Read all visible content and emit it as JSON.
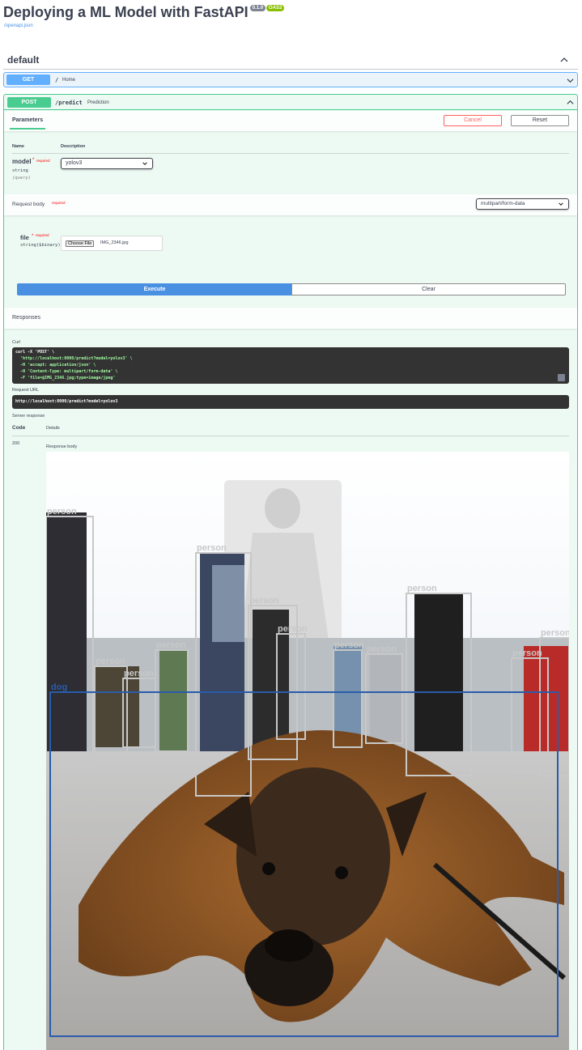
{
  "header": {
    "title": "Deploying a ML Model with FastAPI",
    "version_badge": "0.1.0",
    "oas_badge": "OAS3",
    "openapi_link": "/openapi.json"
  },
  "tag": {
    "name": "default"
  },
  "get_op": {
    "method": "GET",
    "path": "/",
    "summary": "Home"
  },
  "post_op": {
    "method": "POST",
    "path": "/predict",
    "summary": "Prediction",
    "tab_parameters": "Parameters",
    "cancel_label": "Cancel",
    "reset_label": "Reset",
    "col_name": "Name",
    "col_description": "Description",
    "param": {
      "name": "model",
      "required_star": "*",
      "required_text": "required",
      "type": "string",
      "location": "(query)",
      "value": "yolov3"
    },
    "request_body": {
      "label": "Request body",
      "required_text": "required",
      "content_type": "multipart/form-data",
      "field_name": "file",
      "field_required_star": "*",
      "field_required_text": "required",
      "field_type": "string($binary)",
      "choose_file_label": "Choose File",
      "file_name": "IMG_2346.jpg"
    },
    "execute_label": "Execute",
    "clear_label": "Clear",
    "responses_label": "Responses",
    "curl_label": "Curl",
    "curl_lines": [
      "curl -X 'POST' \\",
      "  'http://localhost:8000/predict?model=yolov3' \\",
      "  -H 'accept: application/json' \\",
      "  -H 'Content-Type: multipart/form-data' \\",
      "  -F 'file=@IMG_2346.jpg;type=image/jpeg'"
    ],
    "request_url_label": "Request URL",
    "request_url": "http://localhost:8000/predict?model=yolov3",
    "server_response_label": "Server response",
    "col_code": "Code",
    "col_details": "Details",
    "response_code": "200",
    "response_body_label": "Response body"
  },
  "detections": [
    {
      "label": "person"
    },
    {
      "label": "person"
    },
    {
      "label": "person"
    },
    {
      "label": "person"
    },
    {
      "label": "person"
    },
    {
      "label": "person"
    },
    {
      "label": "person"
    },
    {
      "label": "person"
    },
    {
      "label": "person"
    },
    {
      "label": "person"
    },
    {
      "label": "person"
    },
    {
      "label": "person"
    },
    {
      "label": "dog"
    }
  ],
  "colors": {
    "get": "#61affe",
    "post": "#49cc90",
    "execute": "#4990e2",
    "cancel": "#ff6060",
    "dog_box": "#2a5caa",
    "person_box": "#c8c8c8"
  }
}
